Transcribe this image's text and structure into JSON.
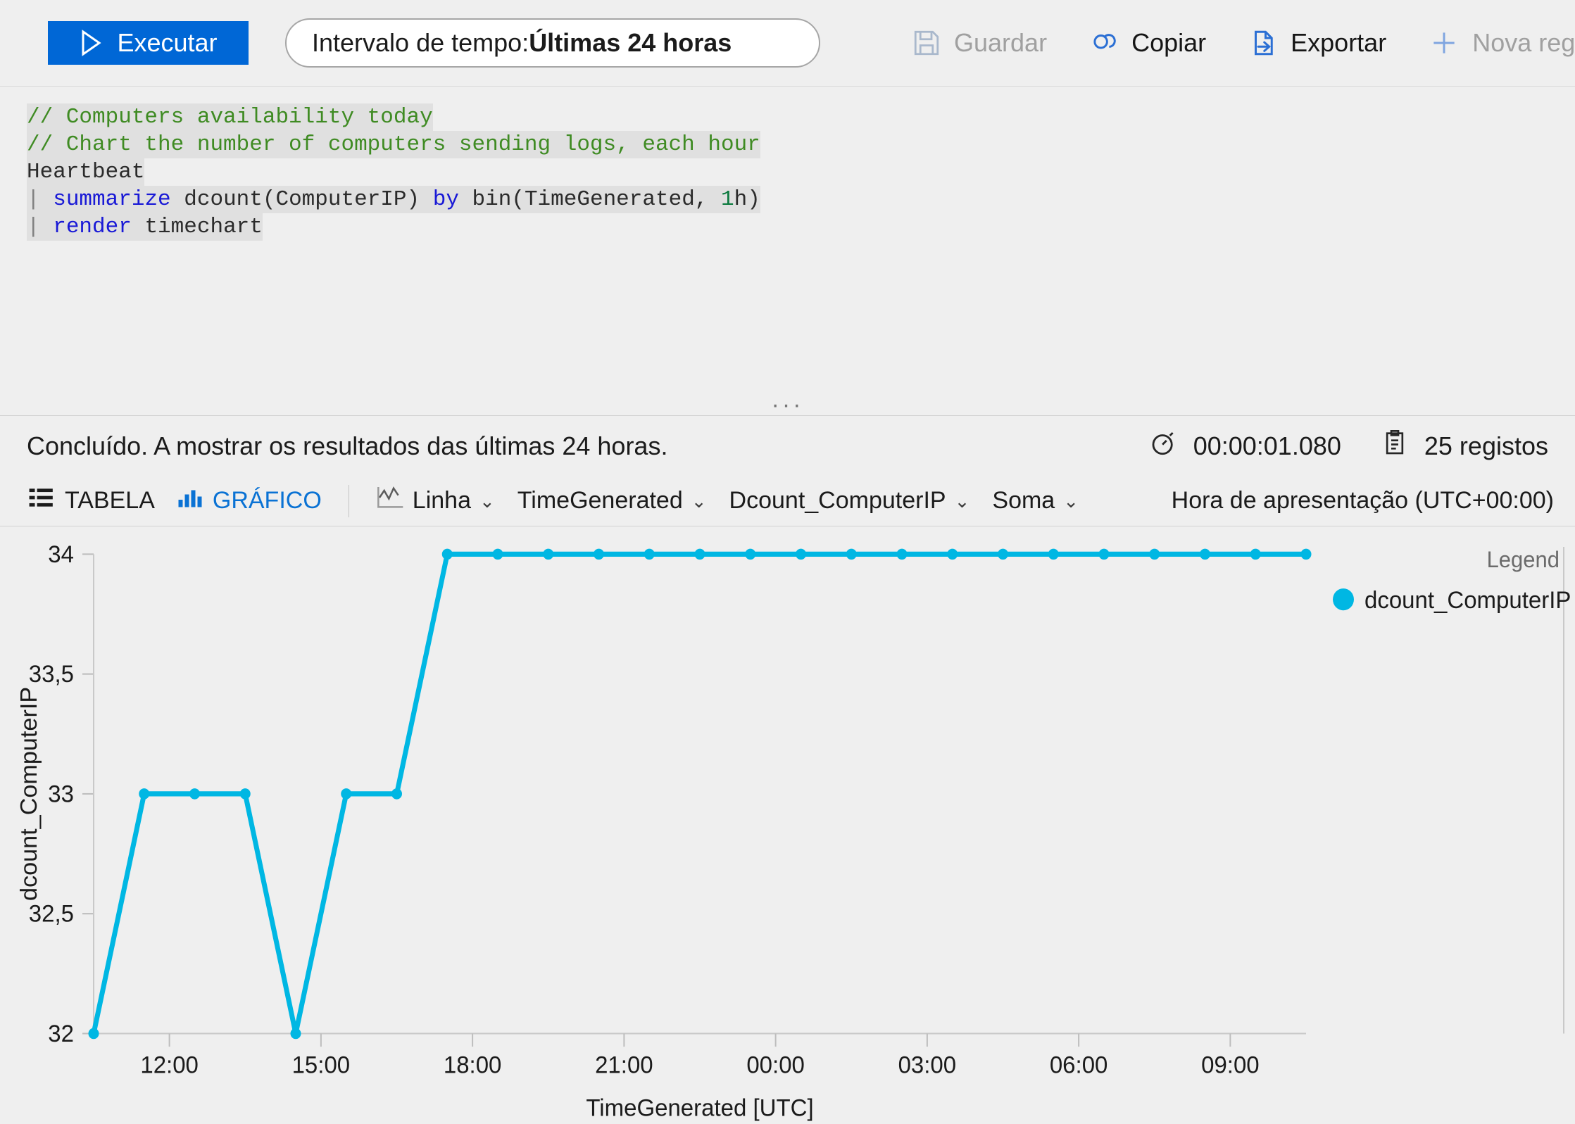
{
  "toolbar": {
    "run_label": "Executar",
    "run_icon": "play-triangle-icon",
    "timepicker_prefix": "Intervalo de tempo: ",
    "timepicker_value": "Últimas 24 horas",
    "items": [
      {
        "label": "Guardar",
        "icon": "save-floppy-icon",
        "state": "disabled"
      },
      {
        "label": "Copiar",
        "icon": "copy-link-icon",
        "state": "enabled"
      },
      {
        "label": "Exportar",
        "icon": "export-file-icon",
        "state": "enabled"
      },
      {
        "label": "Nova regra",
        "icon": "plus-icon",
        "state": "disabled"
      }
    ]
  },
  "editor": {
    "lines": [
      "// Computers availability today",
      "// Chart the number of computers sending logs, each hour",
      "Heartbeat",
      "| summarize dcount(ComputerIP) by bin(TimeGenerated, 1h)",
      "| render timechart"
    ],
    "grip": "···"
  },
  "results": {
    "status": "Concluído. A mostrar os resultados das últimas 24 horas.",
    "duration": "00:00:01.080",
    "duration_icon": "stopwatch-icon",
    "records": "25 registos",
    "records_icon": "clipboard-icon"
  },
  "view_tabs": [
    {
      "label": "TABELA",
      "icon": "table-icon",
      "selected": false
    },
    {
      "label": "GRÁFICO",
      "icon": "bar-chart-icon",
      "selected": true
    }
  ],
  "chart_controls": [
    {
      "label": "Linha",
      "icon": "line-chart-icon"
    },
    {
      "label": "TimeGenerated",
      "icon": ""
    },
    {
      "label": "Dcount_ComputerIP",
      "icon": ""
    },
    {
      "label": "Soma",
      "icon": ""
    }
  ],
  "timezone_label": "Hora de apresentação (UTC+00:00)",
  "colors": {
    "accent_blue": "#0067d6",
    "link_blue": "#0a72d4",
    "series_cyan": "#00b7e3",
    "panel_bg": "#efefef",
    "comment_green": "#3f8b23",
    "keyword_blue": "#1919d6"
  },
  "chart_data": {
    "type": "line",
    "title": "",
    "xlabel": "TimeGenerated [UTC]",
    "ylabel": "dcount_ComputerIP",
    "ylim": [
      32,
      34
    ],
    "yticks": [
      32,
      32.5,
      33,
      33.5,
      34
    ],
    "ytick_labels": [
      "32",
      "32,5",
      "33",
      "33,5",
      "34"
    ],
    "xticks": [
      "12:00",
      "15:00",
      "18:00",
      "21:00",
      "00:00",
      "03:00",
      "06:00",
      "09:00"
    ],
    "xtick_positions": [
      1.5,
      4.5,
      7.5,
      10.5,
      13.5,
      16.5,
      19.5,
      22.5
    ],
    "grid": false,
    "legend_header": "Legend",
    "legend_position": "right",
    "series": [
      {
        "name": "dcount_ComputerIP",
        "color": "#00b7e3",
        "x": [
          "10:30",
          "11:30",
          "12:30",
          "13:30",
          "14:30",
          "15:30",
          "16:30",
          "17:30",
          "18:30",
          "19:30",
          "20:30",
          "21:30",
          "22:30",
          "23:30",
          "00:30",
          "01:30",
          "02:30",
          "03:30",
          "04:30",
          "05:30",
          "06:30",
          "07:30",
          "08:30",
          "09:30",
          "10:30"
        ],
        "values": [
          32,
          33,
          33,
          33,
          32,
          33,
          33,
          34,
          34,
          34,
          34,
          34,
          34,
          34,
          34,
          34,
          34,
          34,
          34,
          34,
          34,
          34,
          34,
          34,
          34
        ]
      }
    ]
  }
}
